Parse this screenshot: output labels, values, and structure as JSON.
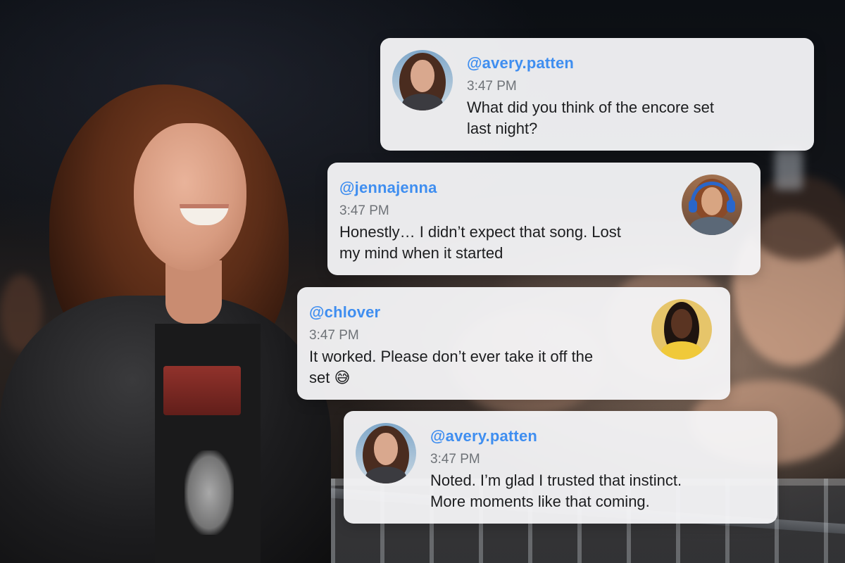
{
  "messages": [
    {
      "handle": "@avery.patten",
      "time": "3:47 PM",
      "text_lines": [
        "What did you think of the encore set",
        "last night?"
      ],
      "avatar_icon": "avery-avatar"
    },
    {
      "handle": "@jennajenna",
      "time": "3:47 PM",
      "text_lines": [
        "Honestly… I didn’t expect that song. Lost",
        "my mind when it started"
      ],
      "avatar_icon": "jennajenna-avatar"
    },
    {
      "handle": "@chlover",
      "time": "3:47 PM",
      "text_lines": [
        "It worked. Please don’t ever take it off the",
        "set 😅"
      ],
      "avatar_icon": "chlover-avatar"
    },
    {
      "handle": "@avery.patten",
      "time": "3:47 PM",
      "text_lines": [
        "Noted. I’m glad I trusted that instinct.",
        "More moments like that coming."
      ],
      "avatar_icon": "avery-avatar"
    }
  ],
  "colors": {
    "handle": "#3f8ef0",
    "bubble_bg": "#f6f6f8",
    "time": "#6f7378",
    "text": "#1c1d1f"
  }
}
